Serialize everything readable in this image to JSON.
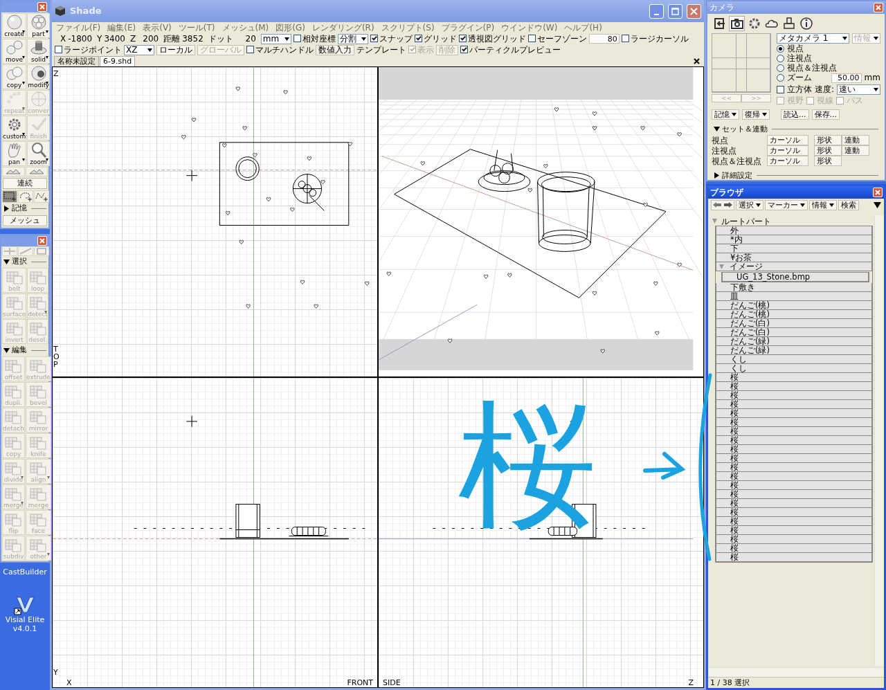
{
  "tool_palette": {
    "tools": [
      {
        "label": "create",
        "disabled": false,
        "menu": true
      },
      {
        "label": "part",
        "disabled": false,
        "menu": true
      },
      {
        "label": "move",
        "disabled": false,
        "menu": true
      },
      {
        "label": "solid",
        "disabled": false,
        "menu": true
      },
      {
        "label": "copy",
        "disabled": false,
        "menu": true
      },
      {
        "label": "modify",
        "disabled": false,
        "menu": true
      },
      {
        "label": "repeat",
        "disabled": true,
        "menu": true
      },
      {
        "label": "conver",
        "disabled": true,
        "menu": false
      },
      {
        "label": "custom",
        "disabled": false,
        "menu": true
      },
      {
        "label": "finish",
        "disabled": true,
        "menu": false
      },
      {
        "label": "pan",
        "disabled": false,
        "menu": true
      },
      {
        "label": "zoom",
        "disabled": false,
        "menu": true
      }
    ],
    "continuous": "連続",
    "select_shapes": [
      {
        "selected": true
      },
      {
        "selected": false
      },
      {
        "selected": false
      }
    ],
    "memory": {
      "label": "記憶",
      "expanded": false
    },
    "mesh_button": "メッシュ"
  },
  "mesh_palette": {
    "sections": [
      {
        "label": "選択",
        "expanded": true,
        "tools": [
          {
            "label": "belt",
            "disabled": true,
            "menu": false
          },
          {
            "label": "loop",
            "disabled": true,
            "menu": false
          },
          {
            "label": "surface",
            "disabled": true,
            "menu": false
          },
          {
            "label": "detect",
            "disabled": true,
            "menu": true
          },
          {
            "label": "invert",
            "disabled": true,
            "menu": false
          },
          {
            "label": "desel.",
            "disabled": true,
            "menu": false
          }
        ]
      },
      {
        "label": "編集",
        "expanded": true,
        "tools": [
          {
            "label": "offset",
            "disabled": true,
            "menu": false
          },
          {
            "label": "extrude",
            "disabled": true,
            "menu": false
          },
          {
            "label": "dupli.",
            "disabled": true,
            "menu": false
          },
          {
            "label": "bevel",
            "disabled": true,
            "menu": false
          },
          {
            "label": "detach",
            "disabled": true,
            "menu": false
          },
          {
            "label": "mirror",
            "disabled": true,
            "menu": false
          },
          {
            "label": "copy",
            "disabled": true,
            "menu": false
          },
          {
            "label": "knife",
            "disabled": true,
            "menu": false
          },
          {
            "label": "divide",
            "disabled": true,
            "menu": true
          },
          {
            "label": "align",
            "disabled": true,
            "menu": true
          },
          {
            "label": "merge",
            "disabled": true,
            "menu": true
          },
          {
            "label": "merge",
            "disabled": true,
            "menu": false
          },
          {
            "label": "flip",
            "disabled": true,
            "menu": false
          },
          {
            "label": "face",
            "disabled": true,
            "menu": false
          },
          {
            "label": "subdiv",
            "disabled": true,
            "menu": false
          },
          {
            "label": "other",
            "disabled": true,
            "menu": true
          }
        ]
      }
    ]
  },
  "desktop": {
    "partial_label": "CastBuilder",
    "icons": [
      {
        "label": "Visial Elite v4.0.1"
      }
    ]
  },
  "main_window": {
    "title": "Shade",
    "menu": [
      "ファイル(F)",
      "編集(E)",
      "表示(V)",
      "ツール(T)",
      "メッシュ(M)",
      "図形(G)",
      "レンダリング(R)",
      "スクリプト(S)",
      "プラグイン(P)",
      "ウインドウ(W)",
      "ヘルプ(H)"
    ],
    "toolbar1": [
      {
        "kind": "label",
        "text": "X"
      },
      {
        "kind": "value",
        "text": "-1800"
      },
      {
        "kind": "label",
        "text": "Y"
      },
      {
        "kind": "value",
        "text": "3400"
      },
      {
        "kind": "label",
        "text": "Z"
      },
      {
        "kind": "value",
        "text": "200"
      },
      {
        "kind": "label",
        "text": "距離"
      },
      {
        "kind": "value",
        "text": "3852"
      },
      {
        "kind": "label",
        "text": "ドット"
      },
      {
        "kind": "value",
        "text": "20"
      },
      {
        "kind": "dropdown",
        "text": "mm"
      },
      {
        "kind": "checkbox",
        "text": "相対座標",
        "checked": false,
        "disabled": false
      },
      {
        "kind": "dropdown",
        "text": "分割"
      },
      {
        "kind": "checkbox",
        "text": "スナップ",
        "checked": true,
        "disabled": false
      },
      {
        "kind": "checkbox",
        "text": "グリッド",
        "checked": true,
        "disabled": false
      },
      {
        "kind": "checkbox",
        "text": "透視図グリッド",
        "checked": true,
        "disabled": false
      },
      {
        "kind": "checkbox",
        "text": "セーフゾーン",
        "checked": false,
        "disabled": false
      },
      {
        "kind": "input",
        "text": "80"
      },
      {
        "kind": "checkbox",
        "text": "ラージカーソル",
        "checked": false,
        "disabled": false
      }
    ],
    "toolbar2": [
      {
        "kind": "checkbox",
        "text": "ラージポイント",
        "checked": false,
        "disabled": false
      },
      {
        "kind": "dropdown",
        "text": "XZ"
      },
      {
        "kind": "button",
        "text": "ローカル",
        "disabled": false
      },
      {
        "kind": "button",
        "text": "グローバル",
        "disabled": true
      },
      {
        "kind": "checkbox",
        "text": "マルチハンドル",
        "checked": false,
        "disabled": false
      },
      {
        "kind": "button",
        "text": "数値入力",
        "disabled": false
      },
      {
        "kind": "label",
        "text": "テンプレート"
      },
      {
        "kind": "checkbox",
        "text": "表示",
        "checked": true,
        "disabled": true
      },
      {
        "kind": "button",
        "text": "削除",
        "disabled": true
      },
      {
        "kind": "checkbox",
        "text": "パーティクルプレビュー",
        "checked": true,
        "disabled": false
      }
    ],
    "tabs": [
      {
        "label": "名称未設定",
        "selected": false
      },
      {
        "label": "6-9.shd",
        "selected": true
      }
    ],
    "viewports": [
      {
        "kind": "top",
        "view_label": "TOP",
        "axis_labels": [
          "Z"
        ]
      },
      {
        "kind": "perspective"
      },
      {
        "kind": "front",
        "view_label": "FRONT",
        "axis_labels": [
          "Y",
          "X"
        ]
      },
      {
        "kind": "side",
        "view_label": "SIDE",
        "axis_labels": [
          "Z"
        ]
      }
    ]
  },
  "camera": {
    "title": "カメラ",
    "icon_tabs": [
      {
        "selected": false
      },
      {
        "selected": true
      },
      {
        "selected": false
      },
      {
        "selected": false
      },
      {
        "selected": false
      },
      {
        "selected": false
      }
    ],
    "nav_buttons": [
      {
        "label": "<<",
        "disabled": true
      },
      {
        "label": ">>",
        "disabled": true
      }
    ],
    "camera_select": "メタカメラ 1",
    "info_select": {
      "label": "情報",
      "disabled": true
    },
    "modes": [
      {
        "label": "視点",
        "selected": true
      },
      {
        "label": "注視点",
        "selected": false
      },
      {
        "label": "視点＆注視点",
        "selected": false
      },
      {
        "label": "ズーム",
        "selected": false
      }
    ],
    "zoom_value": "50.00",
    "zoom_unit": "mm",
    "cube": {
      "label": "立方体",
      "checked": false
    },
    "speed_label": "速度:",
    "speed": "速い",
    "view_options": [
      {
        "label": "視野",
        "checked": false,
        "disabled": true
      },
      {
        "label": "視線",
        "checked": false,
        "disabled": true
      },
      {
        "label": "パス",
        "checked": false,
        "disabled": true
      }
    ],
    "actions": [
      {
        "label": "記憶",
        "menu": true
      },
      {
        "label": "復帰",
        "menu": true
      },
      {
        "label": "読込...",
        "menu": false
      },
      {
        "label": "保存...",
        "menu": false
      }
    ],
    "set_section": {
      "label": "セット＆連動",
      "expanded": true
    },
    "set_rows": [
      {
        "label": "視点",
        "buttons": [
          "カーソル",
          "形状",
          "連動"
        ]
      },
      {
        "label": "注視点",
        "buttons": [
          "カーソル",
          "形状",
          "連動"
        ]
      },
      {
        "label": "視点＆注視点",
        "buttons": [
          "カーソル",
          "形状"
        ]
      }
    ],
    "details": {
      "label": "詳細設定",
      "expanded": false
    }
  },
  "browser": {
    "title": "ブラウザ",
    "toolbar": [
      {
        "label": "選択",
        "menu": true
      },
      {
        "label": "マーカー",
        "menu": true
      },
      {
        "label": "情報",
        "menu": true
      },
      {
        "label": "検索",
        "menu": false
      }
    ],
    "tree": [
      {
        "label": "ルートパート",
        "expanded": true,
        "children": [
          {
            "label": "外"
          },
          {
            "label": "*内"
          },
          {
            "label": "下"
          },
          {
            "label": "¥お茶"
          },
          {
            "label": "イメージ",
            "expanded": true,
            "children": [
              {
                "label": "UG_13_Stone.bmp"
              }
            ]
          },
          {
            "label": "下敷き"
          },
          {
            "label": "皿"
          },
          {
            "label": "だんご(桃)"
          },
          {
            "label": "だんご(桃)"
          },
          {
            "label": "だんご(白)"
          },
          {
            "label": "だんご(白)"
          },
          {
            "label": "だんご(緑)"
          },
          {
            "label": "だんご(緑)"
          },
          {
            "label": "くし"
          },
          {
            "label": "くし"
          },
          {
            "label": "桜"
          },
          {
            "label": "桜"
          },
          {
            "label": "桜"
          },
          {
            "label": "桜"
          },
          {
            "label": "桜"
          },
          {
            "label": "桜"
          },
          {
            "label": "桜"
          },
          {
            "label": "桜"
          },
          {
            "label": "桜"
          },
          {
            "label": "桜"
          },
          {
            "label": "桜"
          },
          {
            "label": "桜"
          },
          {
            "label": "桜"
          },
          {
            "label": "桜"
          },
          {
            "label": "桜"
          },
          {
            "label": "桜"
          },
          {
            "label": "桜"
          },
          {
            "label": "桜"
          },
          {
            "label": "桜"
          },
          {
            "label": "桜"
          },
          {
            "label": "桜"
          }
        ]
      }
    ],
    "status": "1 / 38 選択"
  },
  "annotation": {
    "text": "桜"
  }
}
